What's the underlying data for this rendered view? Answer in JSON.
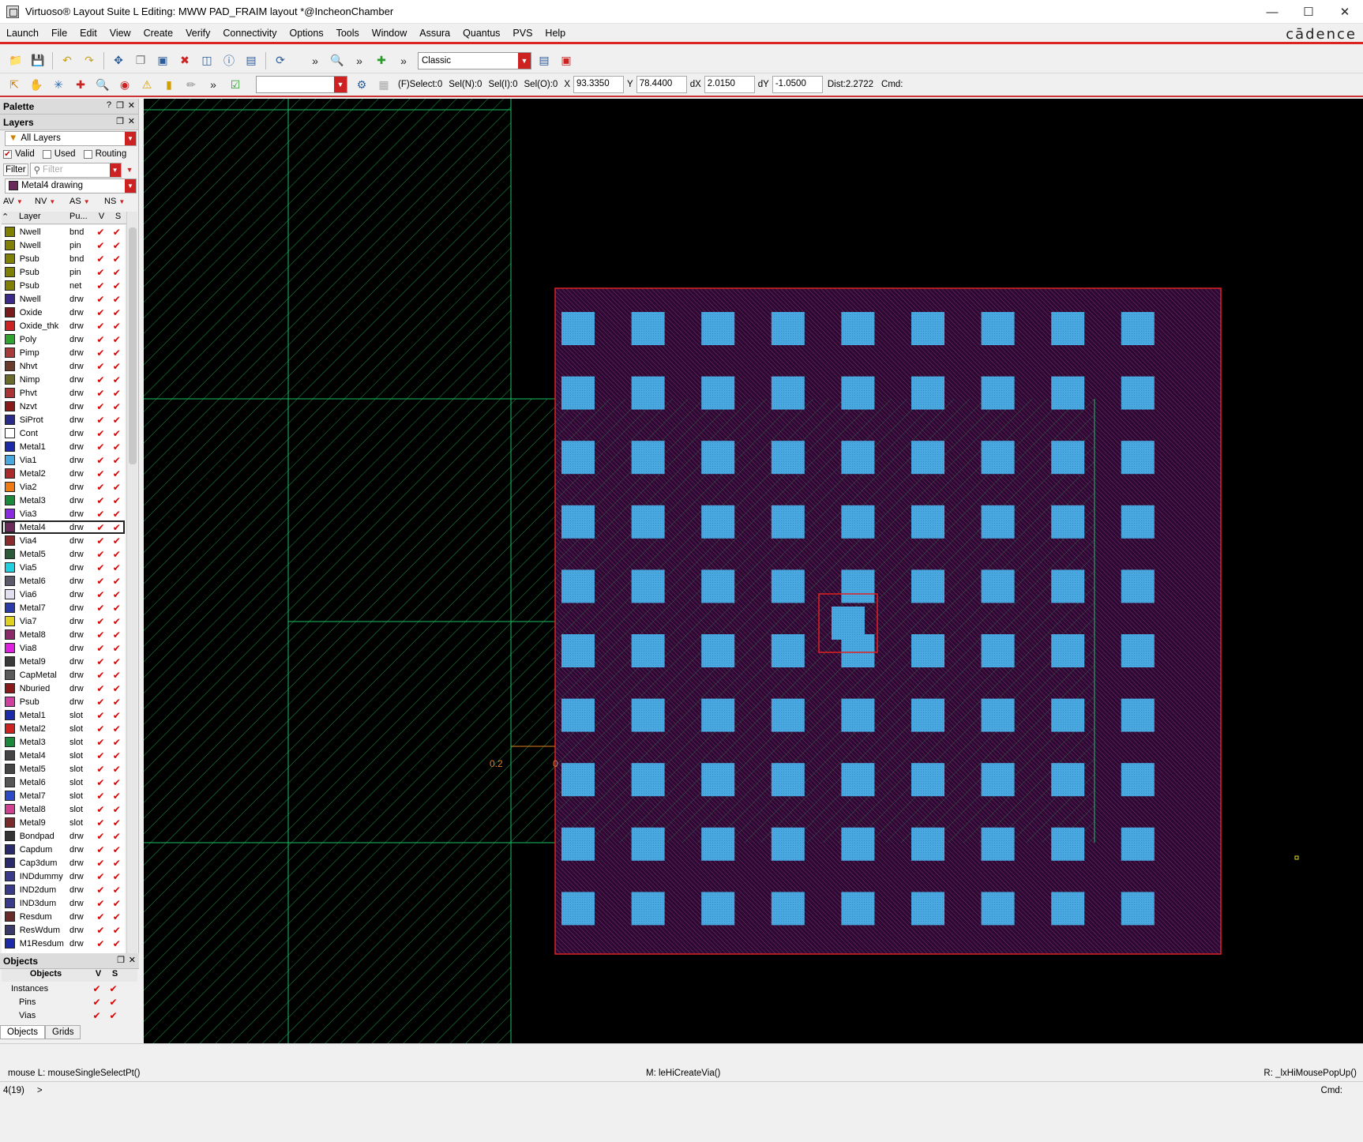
{
  "window": {
    "title": "Virtuoso® Layout Suite L Editing: MWW PAD_FRAIM layout *@IncheonChamber",
    "min": "—",
    "max": "☐",
    "close": "✕"
  },
  "menu": [
    "Launch",
    "File",
    "Edit",
    "View",
    "Create",
    "Verify",
    "Connectivity",
    "Options",
    "Tools",
    "Window",
    "Assura",
    "Quantus",
    "PVS",
    "Help"
  ],
  "brand": "cādence",
  "toolbar": {
    "workspace": "Classic",
    "more": "»"
  },
  "selbar": {
    "fselect": "(F)Select:0",
    "seln": "Sel(N):0",
    "seli": "Sel(I):0",
    "selo": "Sel(O):0",
    "x_label": "X",
    "x": "93.3350",
    "y_label": "Y",
    "y": "78.4400",
    "dx_label": "dX",
    "dx": "2.0150",
    "dy_label": "dY",
    "dy": "-1.0500",
    "dist": "Dist:2.2722",
    "cmd": "Cmd:"
  },
  "palette": {
    "title": "Palette",
    "layers_title": "Layers",
    "filter_combo": "All Layers",
    "valid": "Valid",
    "used": "Used",
    "routing": "Routing",
    "filter_btn": "Filter",
    "filter_placeholder": "Filter",
    "current_layer": "Metal4 drawing",
    "vis": [
      "AV",
      "NV",
      "AS",
      "NS"
    ],
    "col_layer": "Layer",
    "col_purpose": "Pu...",
    "col_v": "V",
    "col_s": "S"
  },
  "layers": [
    {
      "name": "Nwell",
      "purpose": "bnd",
      "color": "#7f7f00"
    },
    {
      "name": "Nwell",
      "purpose": "pin",
      "color": "#7f7f00"
    },
    {
      "name": "Psub",
      "purpose": "bnd",
      "color": "#7f7f00"
    },
    {
      "name": "Psub",
      "purpose": "pin",
      "color": "#7f7f00"
    },
    {
      "name": "Psub",
      "purpose": "net",
      "color": "#7f7f00"
    },
    {
      "name": "Nwell",
      "purpose": "drw",
      "color": "#3b2a8a"
    },
    {
      "name": "Oxide",
      "purpose": "drw",
      "color": "#7a1b1b"
    },
    {
      "name": "Oxide_thk",
      "purpose": "drw",
      "color": "#cc2222"
    },
    {
      "name": "Poly",
      "purpose": "drw",
      "color": "#2fa32f"
    },
    {
      "name": "Pimp",
      "purpose": "drw",
      "color": "#a83a3a"
    },
    {
      "name": "Nhvt",
      "purpose": "drw",
      "color": "#6a3a2a"
    },
    {
      "name": "Nimp",
      "purpose": "drw",
      "color": "#6a6a2a"
    },
    {
      "name": "Phvt",
      "purpose": "drw",
      "color": "#aa3333"
    },
    {
      "name": "Nzvt",
      "purpose": "drw",
      "color": "#8a1a1a"
    },
    {
      "name": "SiProt",
      "purpose": "drw",
      "color": "#2a2a8a"
    },
    {
      "name": "Cont",
      "purpose": "drw",
      "color": "#ffffff"
    },
    {
      "name": "Metal1",
      "purpose": "drw",
      "color": "#1a2aa8"
    },
    {
      "name": "Via1",
      "purpose": "drw",
      "color": "#4aa8e0"
    },
    {
      "name": "Metal2",
      "purpose": "drw",
      "color": "#aa2a2a"
    },
    {
      "name": "Via2",
      "purpose": "drw",
      "color": "#f07a10"
    },
    {
      "name": "Metal3",
      "purpose": "drw",
      "color": "#1a8a3a"
    },
    {
      "name": "Via3",
      "purpose": "drw",
      "color": "#8a2ae0"
    },
    {
      "name": "Metal4",
      "purpose": "drw",
      "color": "#6a2a5a"
    },
    {
      "name": "Via4",
      "purpose": "drw",
      "color": "#8a2a2a"
    },
    {
      "name": "Metal5",
      "purpose": "drw",
      "color": "#2a5a3a"
    },
    {
      "name": "Via5",
      "purpose": "drw",
      "color": "#20d0e0"
    },
    {
      "name": "Metal6",
      "purpose": "drw",
      "color": "#5a5a6a"
    },
    {
      "name": "Via6",
      "purpose": "drw",
      "color": "#e0e0f0"
    },
    {
      "name": "Metal7",
      "purpose": "drw",
      "color": "#2a3aa8"
    },
    {
      "name": "Via7",
      "purpose": "drw",
      "color": "#e0d020"
    },
    {
      "name": "Metal8",
      "purpose": "drw",
      "color": "#8a2a6a"
    },
    {
      "name": "Via8",
      "purpose": "drw",
      "color": "#e020e0"
    },
    {
      "name": "Metal9",
      "purpose": "drw",
      "color": "#3a3a3a"
    },
    {
      "name": "CapMetal",
      "purpose": "drw",
      "color": "#5a5a5a"
    },
    {
      "name": "Nburied",
      "purpose": "drw",
      "color": "#8a1a1a"
    },
    {
      "name": "Psub",
      "purpose": "drw",
      "color": "#d040a0"
    },
    {
      "name": "Metal1",
      "purpose": "slot",
      "color": "#1a2aa8"
    },
    {
      "name": "Metal2",
      "purpose": "slot",
      "color": "#cc2222"
    },
    {
      "name": "Metal3",
      "purpose": "slot",
      "color": "#1a8a3a"
    },
    {
      "name": "Metal4",
      "purpose": "slot",
      "color": "#444444"
    },
    {
      "name": "Metal5",
      "purpose": "slot",
      "color": "#444444"
    },
    {
      "name": "Metal6",
      "purpose": "slot",
      "color": "#555555"
    },
    {
      "name": "Metal7",
      "purpose": "slot",
      "color": "#2a4ac8"
    },
    {
      "name": "Metal8",
      "purpose": "slot",
      "color": "#d04090"
    },
    {
      "name": "Metal9",
      "purpose": "slot",
      "color": "#7a2a2a"
    },
    {
      "name": "Bondpad",
      "purpose": "drw",
      "color": "#333333"
    },
    {
      "name": "Capdum",
      "purpose": "drw",
      "color": "#2a2a6a"
    },
    {
      "name": "Cap3dum",
      "purpose": "drw",
      "color": "#2a2a6a"
    },
    {
      "name": "INDdummy",
      "purpose": "drw",
      "color": "#3a3a8a"
    },
    {
      "name": "IND2dum",
      "purpose": "drw",
      "color": "#3a3a8a"
    },
    {
      "name": "IND3dum",
      "purpose": "drw",
      "color": "#3a3a8a"
    },
    {
      "name": "Resdum",
      "purpose": "drw",
      "color": "#6a2a2a"
    },
    {
      "name": "ResWdum",
      "purpose": "drw",
      "color": "#3a3a6a"
    },
    {
      "name": "M1Resdum",
      "purpose": "drw",
      "color": "#1a2aa8"
    }
  ],
  "selected_layer_index": 22,
  "objects": {
    "title": "Objects",
    "col": "Objects",
    "col_v": "V",
    "col_s": "S",
    "items": [
      "Instances",
      "Pins",
      "Vias"
    ],
    "tabs": [
      "Objects",
      "Grids"
    ]
  },
  "canvas": {
    "ruler_label_left": "0.2",
    "ruler_label_right": "0"
  },
  "status": {
    "mouse_l": "mouse L: mouseSingleSelectPt()",
    "mouse_m": "M: leHiCreateVia()",
    "mouse_r": "R: _lxHiMousePopUp()",
    "count": "4(19)",
    "prompt": ">",
    "cmd": "Cmd:"
  }
}
